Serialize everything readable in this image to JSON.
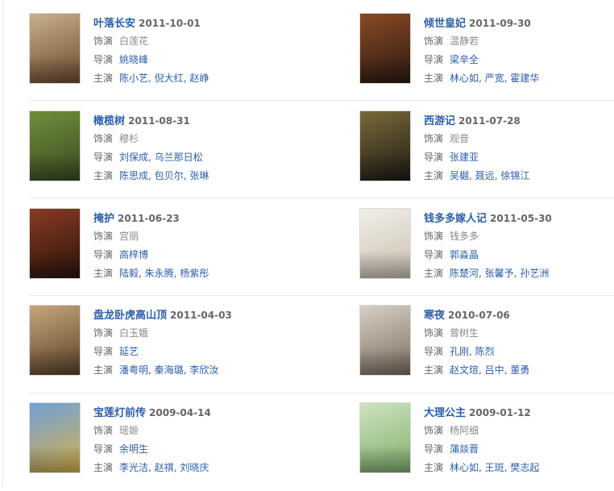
{
  "labels": {
    "role": "饰演",
    "director": "导演",
    "cast": "主演"
  },
  "items": [
    {
      "title": "叶落长安",
      "date": "2011-10-01",
      "role": "白莲花",
      "directors": [
        "姚晓峰"
      ],
      "cast": [
        "陈小艺",
        "倪大红",
        "赵峥"
      ],
      "poster_colors": [
        "#c9b08a",
        "#6b4b2f"
      ]
    },
    {
      "title": "倾世皇妃",
      "date": "2011-09-30",
      "role": "温静若",
      "directors": [
        "梁辛全"
      ],
      "cast": [
        "林心如",
        "严宽",
        "霍建华"
      ],
      "poster_colors": [
        "#8a4a24",
        "#2a1a12"
      ]
    },
    {
      "title": "橄榄树",
      "date": "2011-08-31",
      "role": "穆杉",
      "directors": [
        "刘保成",
        "乌兰那日松"
      ],
      "cast": [
        "陈思成",
        "包贝尔",
        "张琳"
      ],
      "poster_colors": [
        "#6f8f3a",
        "#3a4a22"
      ]
    },
    {
      "title": "西游记",
      "date": "2011-07-28",
      "role": "观音",
      "directors": [
        "张建亚"
      ],
      "cast": [
        "吴樾",
        "聂远",
        "徐锦江"
      ],
      "poster_colors": [
        "#7a6a3a",
        "#1d1a14"
      ]
    },
    {
      "title": "掩护",
      "date": "2011-06-23",
      "role": "宫丽",
      "directors": [
        "高梓博"
      ],
      "cast": [
        "陆毅",
        "朱永腾",
        "杨紫彤"
      ],
      "poster_colors": [
        "#8a3a22",
        "#2a140c"
      ]
    },
    {
      "title": "钱多多嫁人记",
      "date": "2011-05-30",
      "role": "钱多多",
      "directors": [
        "郭淼晶"
      ],
      "cast": [
        "陈楚河",
        "张馨予",
        "孙艺洲"
      ],
      "poster_colors": [
        "#f2efe8",
        "#c9c0b0"
      ]
    },
    {
      "title": "盘龙卧虎高山顶",
      "date": "2011-04-03",
      "role": "白玉娥",
      "directors": [
        "延艺"
      ],
      "cast": [
        "潘粤明",
        "秦海璐",
        "李欣汝"
      ],
      "poster_colors": [
        "#c7a77a",
        "#5a4028"
      ]
    },
    {
      "title": "寒夜",
      "date": "2010-07-06",
      "role": "曾树生",
      "directors": [
        "孔刚",
        "陈烈"
      ],
      "cast": [
        "赵文瑄",
        "吕中",
        "董勇"
      ],
      "poster_colors": [
        "#d8cfc4",
        "#7d6e62"
      ]
    },
    {
      "title": "宝莲灯前传",
      "date": "2009-04-14",
      "role": "瑶姬",
      "directors": [
        "余明生"
      ],
      "cast": [
        "李光洁",
        "赵祺",
        "刘晓庆"
      ],
      "poster_colors": [
        "#6fa0d8",
        "#d9b24a"
      ]
    },
    {
      "title": "大理公主",
      "date": "2009-01-12",
      "role": "杨阿细",
      "directors": [
        "蒲燚晋"
      ],
      "cast": [
        "林心如",
        "王斑",
        "樊志起"
      ],
      "poster_colors": [
        "#cfe3c0",
        "#7fb06a"
      ]
    }
  ]
}
